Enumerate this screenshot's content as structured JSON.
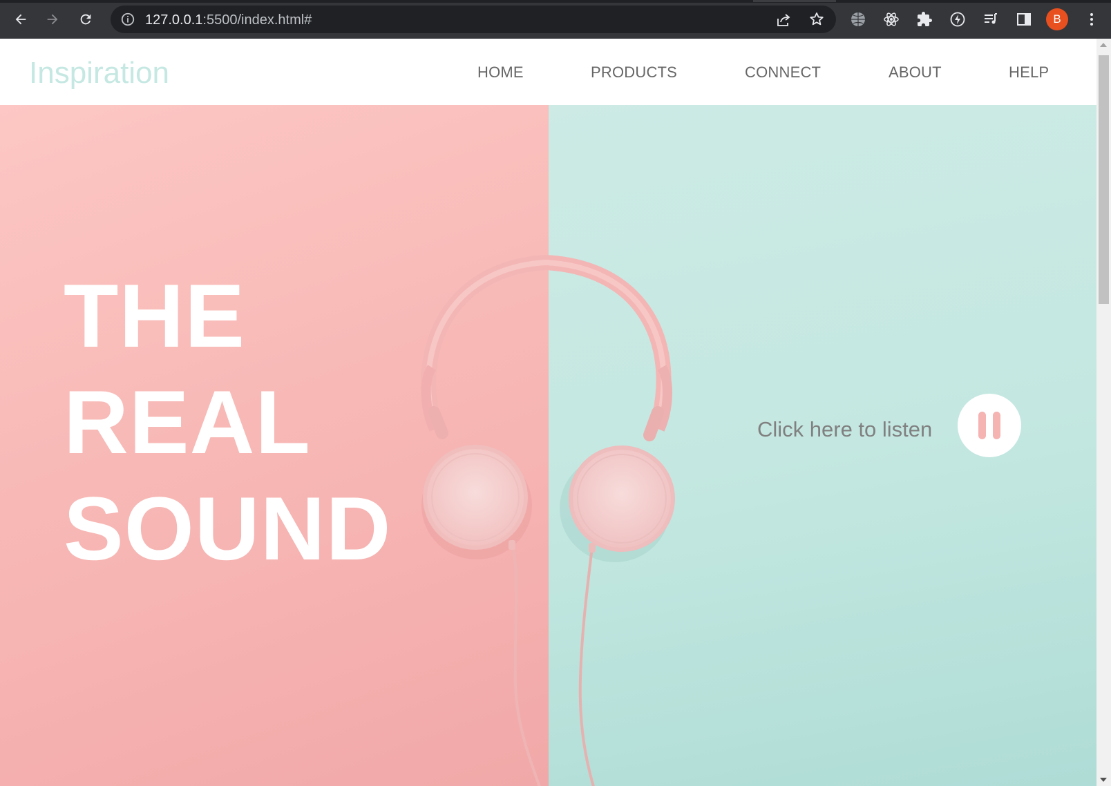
{
  "browser": {
    "url_host": "127.0.0.1",
    "url_rest": ":5500/index.html#",
    "profile_initial": "B",
    "icons": [
      "back-icon",
      "forward-icon",
      "reload-icon",
      "info-icon",
      "share-icon",
      "star-icon",
      "globe-icon",
      "react-icon",
      "extensions-icon",
      "lightning-icon",
      "reading-list-icon",
      "side-panel-icon",
      "menu-icon"
    ]
  },
  "site": {
    "logo": "Inspiration",
    "nav": [
      {
        "label": "HOME"
      },
      {
        "label": "PRODUCTS"
      },
      {
        "label": "CONNECT"
      },
      {
        "label": "ABOUT"
      },
      {
        "label": "HELP"
      }
    ]
  },
  "hero": {
    "headline": [
      "THE",
      "REAL",
      "SOUND"
    ],
    "listen_text": "Click here to listen",
    "play_button_icon": "pause-icon"
  },
  "colors": {
    "pink": "#f8b9b6",
    "mint": "#c4e8e1",
    "logo": "#c6e8e2",
    "nav_text": "#666666",
    "pause_bars": "#f5b3b2"
  }
}
